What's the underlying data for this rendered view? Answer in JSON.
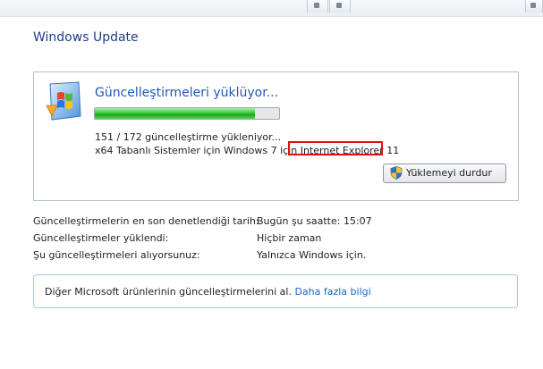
{
  "window": {
    "title": "Windows Update"
  },
  "status": {
    "heading": "Güncelleştirmeleri yüklüyor...",
    "progress_fraction": 0.87,
    "count_text": "151 / 172 güncelleştirme yükleniyor...",
    "arch_text_prefix": "x64 Tabanlı Sistemler için Windows 7 için ",
    "current_update": "Internet Explorer 11",
    "stop_button": "Yüklemeyi durdur"
  },
  "info": [
    {
      "label": "Güncelleştirmelerin en son denetlendiği tarih:",
      "value": "Bugün şu saatte: 15:07"
    },
    {
      "label": "Güncelleştirmeler yüklendi:",
      "value": "Hiçbir zaman"
    },
    {
      "label": "Şu güncelleştirmeleri alıyorsunuz:",
      "value": "Yalnızca Windows için."
    }
  ],
  "more": {
    "text": "Diğer Microsoft ürünlerinin güncelleştirmelerini al. ",
    "link": "Daha fazla bilgi"
  },
  "colors": {
    "title": "#1e3d8a",
    "highlight": "#e01010",
    "link": "#1a64c8",
    "progress": "#3cc83a"
  }
}
